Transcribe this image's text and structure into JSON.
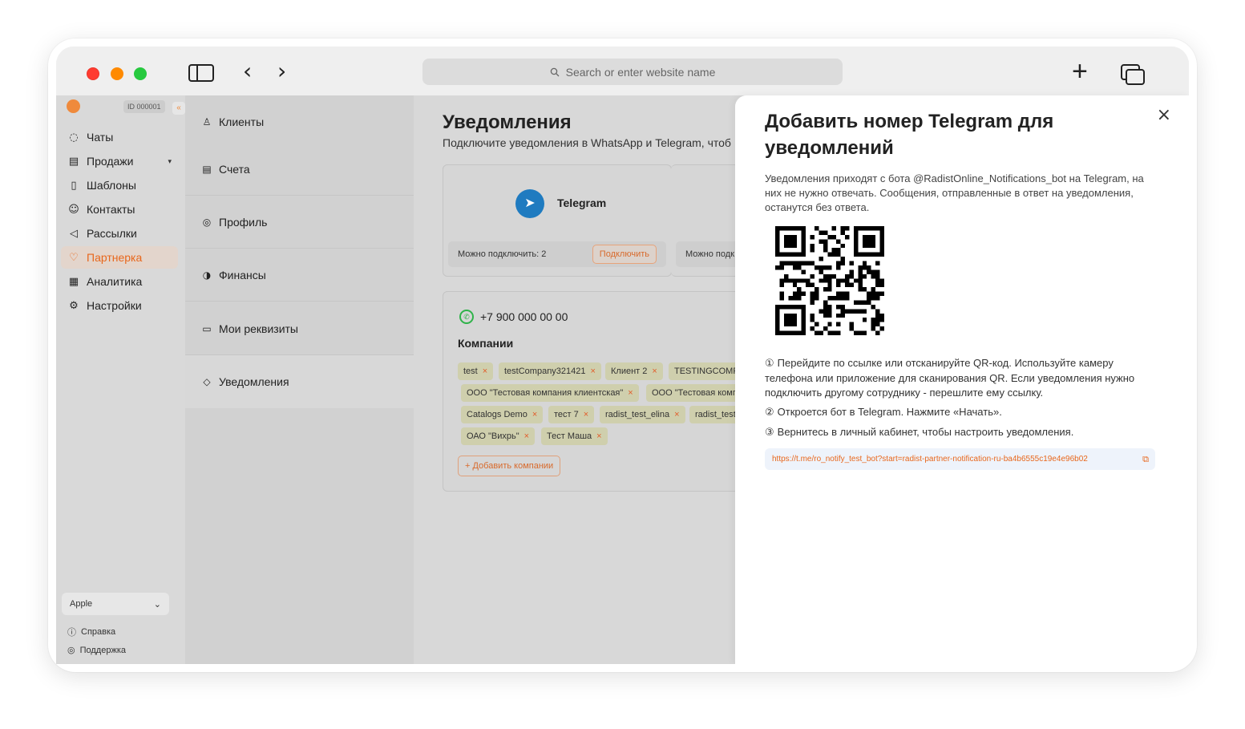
{
  "browser": {
    "address_placeholder": "Search or enter website name",
    "back_glyph": "‹",
    "forward_glyph": "›",
    "new_tab_glyph": "+"
  },
  "sidebar": {
    "id_badge": "ID 000001",
    "collapse_glyph": "«",
    "items": [
      {
        "label": "Чаты",
        "icon": "chat-icon",
        "glyph": "◌"
      },
      {
        "label": "Продажи",
        "icon": "store-icon",
        "glyph": "▤"
      },
      {
        "label": "Шаблоны",
        "icon": "document-icon",
        "glyph": "▯"
      },
      {
        "label": "Контакты",
        "icon": "contacts-icon",
        "glyph": "☺"
      },
      {
        "label": "Рассылки",
        "icon": "megaphone-icon",
        "glyph": "◁"
      },
      {
        "label": "Партнерка",
        "icon": "heart-handshake-icon",
        "glyph": "♡"
      },
      {
        "label": "Аналитика",
        "icon": "analytics-icon",
        "glyph": "▦"
      },
      {
        "label": "Настройки",
        "icon": "gear-icon",
        "glyph": "⚙"
      }
    ],
    "workspace_select": "Apple",
    "help_label": "Справка",
    "support_label": "Поддержка",
    "help_glyph": "ⓘ",
    "support_glyph": "◎",
    "colors": {
      "accent": "#e8671c"
    }
  },
  "submenu": {
    "items": [
      {
        "label": "Клиенты",
        "glyph": "♙"
      },
      {
        "label": "Счета",
        "glyph": "▤"
      },
      {
        "label": "Профиль",
        "glyph": "◎"
      },
      {
        "label": "Финансы",
        "glyph": "◑"
      },
      {
        "label": "Мои реквизиты",
        "glyph": "▭"
      },
      {
        "label": "Уведомления",
        "glyph": "◇"
      }
    ]
  },
  "main": {
    "title": "Уведомления",
    "subtitle": "Подключите уведомления в WhatsApp и Telegram, чтоб",
    "telegram_card": {
      "name": "Telegram",
      "available": "Можно подключить: 2",
      "connect": "Подключить"
    },
    "second_card_available": "Можно подк",
    "phone": "+7 900 000 00 00",
    "companies_label": "Компании",
    "tags": [
      "test",
      "testCompany321421",
      "Клиент 2",
      "TESTINGCOMP",
      "ООО \"Тестовая компания клиентская\"",
      "ООО \"Тестовая комп",
      "Catalogs Demo",
      "тест 7",
      "radist_test_elina",
      "radist_test",
      "ОАО \"Вихрь\"",
      "Тест Маша"
    ],
    "remove_glyph": "×",
    "add_companies": "+ Добавить компании"
  },
  "drawer": {
    "title": "Добавить номер Telegram для уведомлений",
    "description": "Уведомления приходят с бота @RadistOnline_Notifications_bot на Telegram, на них не нужно отвечать. Сообщения, отправленные в ответ на уведомления, останутся без ответа.",
    "steps": [
      {
        "num": "①",
        "text": "Перейдите по ссылке или отсканируйте QR-код. Используйте камеру телефона или приложение для сканирования QR. Если уведомления нужно подключить другому сотруднику - перешлите ему ссылку."
      },
      {
        "num": "②",
        "text": "Откроется бот в Telegram. Нажмите «Начать»."
      },
      {
        "num": "③",
        "text": "Вернитесь в личный кабинет, чтобы настроить уведомления."
      }
    ],
    "link": "https://t.me/ro_notify_test_bot?start=radist-partner-notification-ru-ba4b6555c19e4e96b02",
    "close_glyph": "×",
    "copy_glyph": "⧉"
  }
}
